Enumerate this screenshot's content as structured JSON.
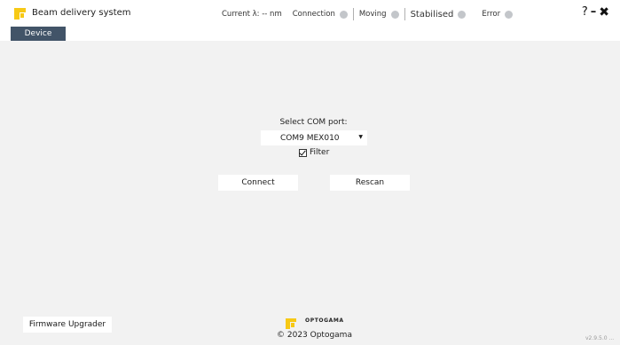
{
  "window": {
    "title": "Beam delivery system",
    "controls": {
      "help": "?",
      "minimize": "–",
      "close": "✖"
    }
  },
  "status": {
    "wavelength": "Current λ: -- nm",
    "connection": "Connection",
    "moving": "Moving",
    "stabilised": "Stabilised",
    "error": "Error",
    "indicator_color": "#c3c6ca"
  },
  "tabs": [
    {
      "label": "Device",
      "active": true
    }
  ],
  "main": {
    "com_label": "Select COM port:",
    "com_selected": "COM9 MEX010",
    "filter_label": "Filter",
    "filter_checked": true,
    "connect_label": "Connect",
    "rescan_label": "Rescan"
  },
  "footer": {
    "firmware_label": "Firmware Upgrader",
    "brand": "OPTOGAMA",
    "copyright": "© 2023 Optogama",
    "version": "v2.9.5.0 ..."
  },
  "colors": {
    "accent": "#425468",
    "logo": "#f7c915",
    "background": "#f2f2f2"
  }
}
